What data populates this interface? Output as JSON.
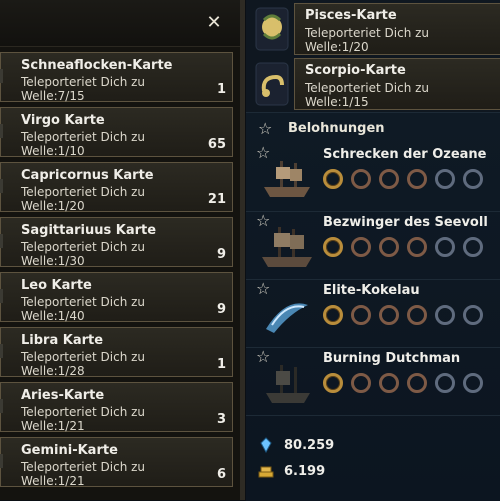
{
  "left_panel": {
    "close_label": "✕",
    "cards": [
      {
        "title": "Schneaflocken-Karte",
        "line1": "Teleporteriet Dich zu",
        "line2": "Welle:7/15",
        "count": "1"
      },
      {
        "title": "Virgo Karte",
        "line1": "Teleporteriet Dich zu",
        "line2": "Welle:1/10",
        "count": "65"
      },
      {
        "title": "Capricornus Karte",
        "line1": "Teleporteriet Dich zu",
        "line2": "Welle:1/20",
        "count": "21"
      },
      {
        "title": "Sagittariuus Karte",
        "line1": "Teleporteriet Dich zu",
        "line2": "Welle:1/30",
        "count": "9"
      },
      {
        "title": "Leo Karte",
        "line1": "Teleporteriet Dich zu",
        "line2": "Welle:1/40",
        "count": "9"
      },
      {
        "title": "Libra Karte",
        "line1": "Teleporteriet Dich zu",
        "line2": "Welle:1/28",
        "count": "1"
      },
      {
        "title": "Aries-Karte",
        "line1": "Teleporteriet Dich zu",
        "line2": "Welle:1/21",
        "count": "3"
      },
      {
        "title": "Gemini-Karte",
        "line1": "Teleporteriet Dich zu",
        "line2": "Welle:1/21",
        "count": "6"
      }
    ]
  },
  "right_panel": {
    "quests": [
      {
        "title": "Pisces-Karte",
        "line1": "Teleporteriet Dich zu",
        "line2": "Welle:1/20",
        "icon": "pisces-icon"
      },
      {
        "title": "Scorpio-Karte",
        "line1": "Teleporteriet Dich zu",
        "line2": "Welle:1/15",
        "icon": "scorpio-icon"
      }
    ],
    "rewards": {
      "header": "Belohnungen",
      "bosses": [
        {
          "name": "Schrecken der Ozeane",
          "rings": [
            "gold",
            "bronze",
            "bronze",
            "bronze",
            "silver",
            "silver"
          ]
        },
        {
          "name": "Bezwinger des Seevoll",
          "rings": [
            "gold",
            "bronze",
            "bronze",
            "bronze",
            "silver",
            "silver"
          ]
        },
        {
          "name": "Elite-Kokelau",
          "rings": [
            "gold",
            "bronze",
            "bronze",
            "bronze",
            "silver",
            "silver"
          ]
        },
        {
          "name": "Burning Dutchman",
          "rings": [
            "gold",
            "bronze",
            "bronze",
            "bronze",
            "silver",
            "silver"
          ]
        }
      ],
      "currency": [
        {
          "value": "80.259",
          "icon": "diamond-icon"
        },
        {
          "value": "6.199",
          "icon": "gold-bars-icon"
        }
      ]
    }
  },
  "colors": {
    "gold_ring": "#b98d3b",
    "bronze_ring": "#7e5a46",
    "silver_ring": "#5f6b7e",
    "text": "#f0eee8"
  }
}
